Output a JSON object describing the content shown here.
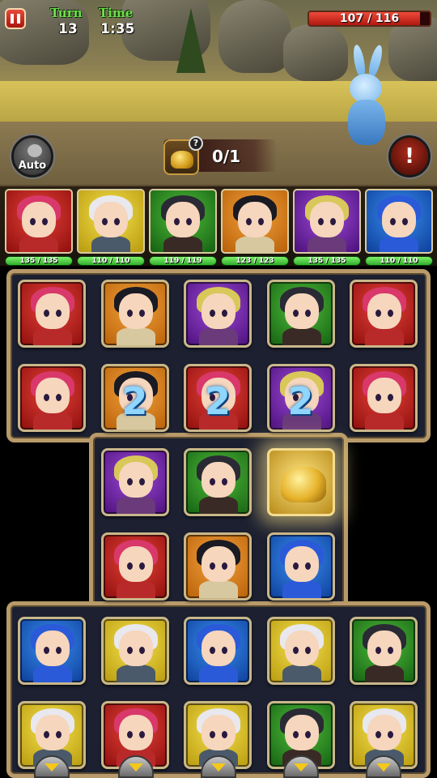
{
  "hud": {
    "turn_label": "Turn",
    "turn_value": "13",
    "time_label": "Time",
    "time_value": "1:35",
    "enemy_hp_text": "107 / 116",
    "enemy_hp_fraction": 0.922,
    "auto_label": "Auto",
    "quest_help": "?",
    "quest_progress": "0/1",
    "skill_icon": "!"
  },
  "party": [
    {
      "hp": "135 / 135",
      "color": "red",
      "hair": "pink"
    },
    {
      "hp": "110 / 110",
      "color": "yellow",
      "hair": "white"
    },
    {
      "hp": "119 / 119",
      "color": "green",
      "hair": "dark"
    },
    {
      "hp": "123 / 123",
      "color": "orange",
      "hair": "ebon"
    },
    {
      "hp": "135 / 135",
      "color": "purple",
      "hair": "blond"
    },
    {
      "hp": "110 / 110",
      "color": "blue",
      "hair": "cap"
    }
  ],
  "board": {
    "rows": [
      [
        {
          "c": "red",
          "h": "pink"
        },
        {
          "c": "orange",
          "h": "ebon"
        },
        {
          "c": "purple",
          "h": "blond"
        },
        {
          "c": "green",
          "h": "dark"
        },
        {
          "c": "red",
          "h": "pink"
        }
      ],
      [
        {
          "c": "red",
          "h": "pink"
        },
        {
          "c": "orange",
          "h": "ebon",
          "n": "2"
        },
        {
          "c": "red",
          "h": "pink",
          "n": "2"
        },
        {
          "c": "purple",
          "h": "blond",
          "n": "2"
        },
        {
          "c": "red",
          "h": "pink"
        }
      ],
      [
        null,
        {
          "c": "purple",
          "h": "blond"
        },
        {
          "c": "green",
          "h": "dark"
        },
        {
          "c": "gold"
        },
        null
      ],
      [
        null,
        {
          "c": "red",
          "h": "pink"
        },
        {
          "c": "orange",
          "h": "ebon"
        },
        {
          "c": "blue",
          "h": "cap"
        },
        null
      ],
      [
        {
          "c": "blue",
          "h": "cap"
        },
        {
          "c": "yellow",
          "h": "white"
        },
        {
          "c": "blue",
          "h": "cap"
        },
        {
          "c": "yellow",
          "h": "white"
        },
        {
          "c": "green",
          "h": "dark"
        }
      ],
      [
        {
          "c": "yellow",
          "h": "white"
        },
        {
          "c": "red",
          "h": "pink"
        },
        {
          "c": "yellow",
          "h": "white"
        },
        {
          "c": "green",
          "h": "dark"
        },
        {
          "c": "yellow",
          "h": "white"
        }
      ]
    ]
  }
}
